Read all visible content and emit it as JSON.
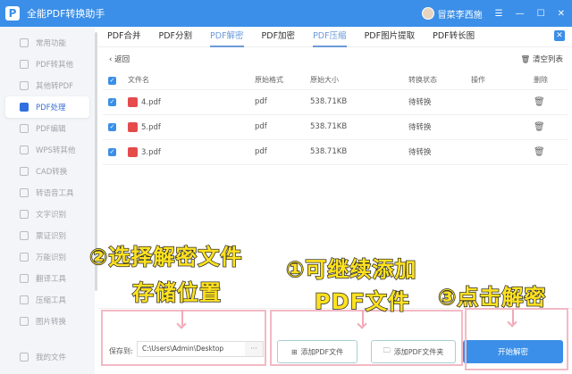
{
  "app": {
    "title": "全能PDF转换助手",
    "logo": "P",
    "user": "冒菜李西施",
    "menu_icon": "☰",
    "min_icon": "—",
    "max_icon": "☐",
    "close_icon": "✕"
  },
  "sidebar": {
    "items": [
      {
        "label": "常用功能"
      },
      {
        "label": "PDF转其他"
      },
      {
        "label": "其他转PDF"
      },
      {
        "label": "PDF处理",
        "active": true
      },
      {
        "label": "PDF编辑"
      },
      {
        "label": "WPS转其他"
      },
      {
        "label": "CAD转换"
      },
      {
        "label": "转语音工具"
      },
      {
        "label": "文字识别"
      },
      {
        "label": "票证识别"
      },
      {
        "label": "万能识别"
      },
      {
        "label": "翻译工具"
      },
      {
        "label": "压缩工具"
      },
      {
        "label": "图片转换"
      }
    ],
    "my_files": "我的文件"
  },
  "tabs": [
    {
      "label": "PDF合并"
    },
    {
      "label": "PDF分割"
    },
    {
      "label": "PDF解密",
      "selected": true
    },
    {
      "label": "PDF加密"
    },
    {
      "label": "PDF压缩",
      "selected": true
    },
    {
      "label": "PDF图片提取"
    },
    {
      "label": "PDF转长图"
    }
  ],
  "toolbar": {
    "back": "‹ 返回",
    "clear": "清空列表"
  },
  "table": {
    "headers": [
      "文件名",
      "原始格式",
      "原始大小",
      "转换状态",
      "操作",
      "删除"
    ],
    "rows": [
      [
        "4.pdf",
        "pdf",
        "538.71KB",
        "待转换"
      ],
      [
        "5.pdf",
        "pdf",
        "538.71KB",
        "待转换"
      ],
      [
        "3.pdf",
        "pdf",
        "538.71KB",
        "待转换"
      ]
    ]
  },
  "bottom": {
    "save_label": "保存到:",
    "save_path": "C:\\Users\\Admin\\Desktop",
    "browse": "···",
    "add_file": "添加PDF文件",
    "add_folder": "添加PDF文件夹",
    "start": "开始解密"
  },
  "annotations": {
    "a2_line1": "②选择解密文件",
    "a2_line2": "存储位置",
    "a1_line1": "①可继续添加",
    "a1_line2": "PDF文件",
    "a3": "③点击解密"
  },
  "colors": {
    "accent": "#3b8fe8",
    "annotation_text": "#ffe21f",
    "annotation_box": "#f2b9c4"
  }
}
